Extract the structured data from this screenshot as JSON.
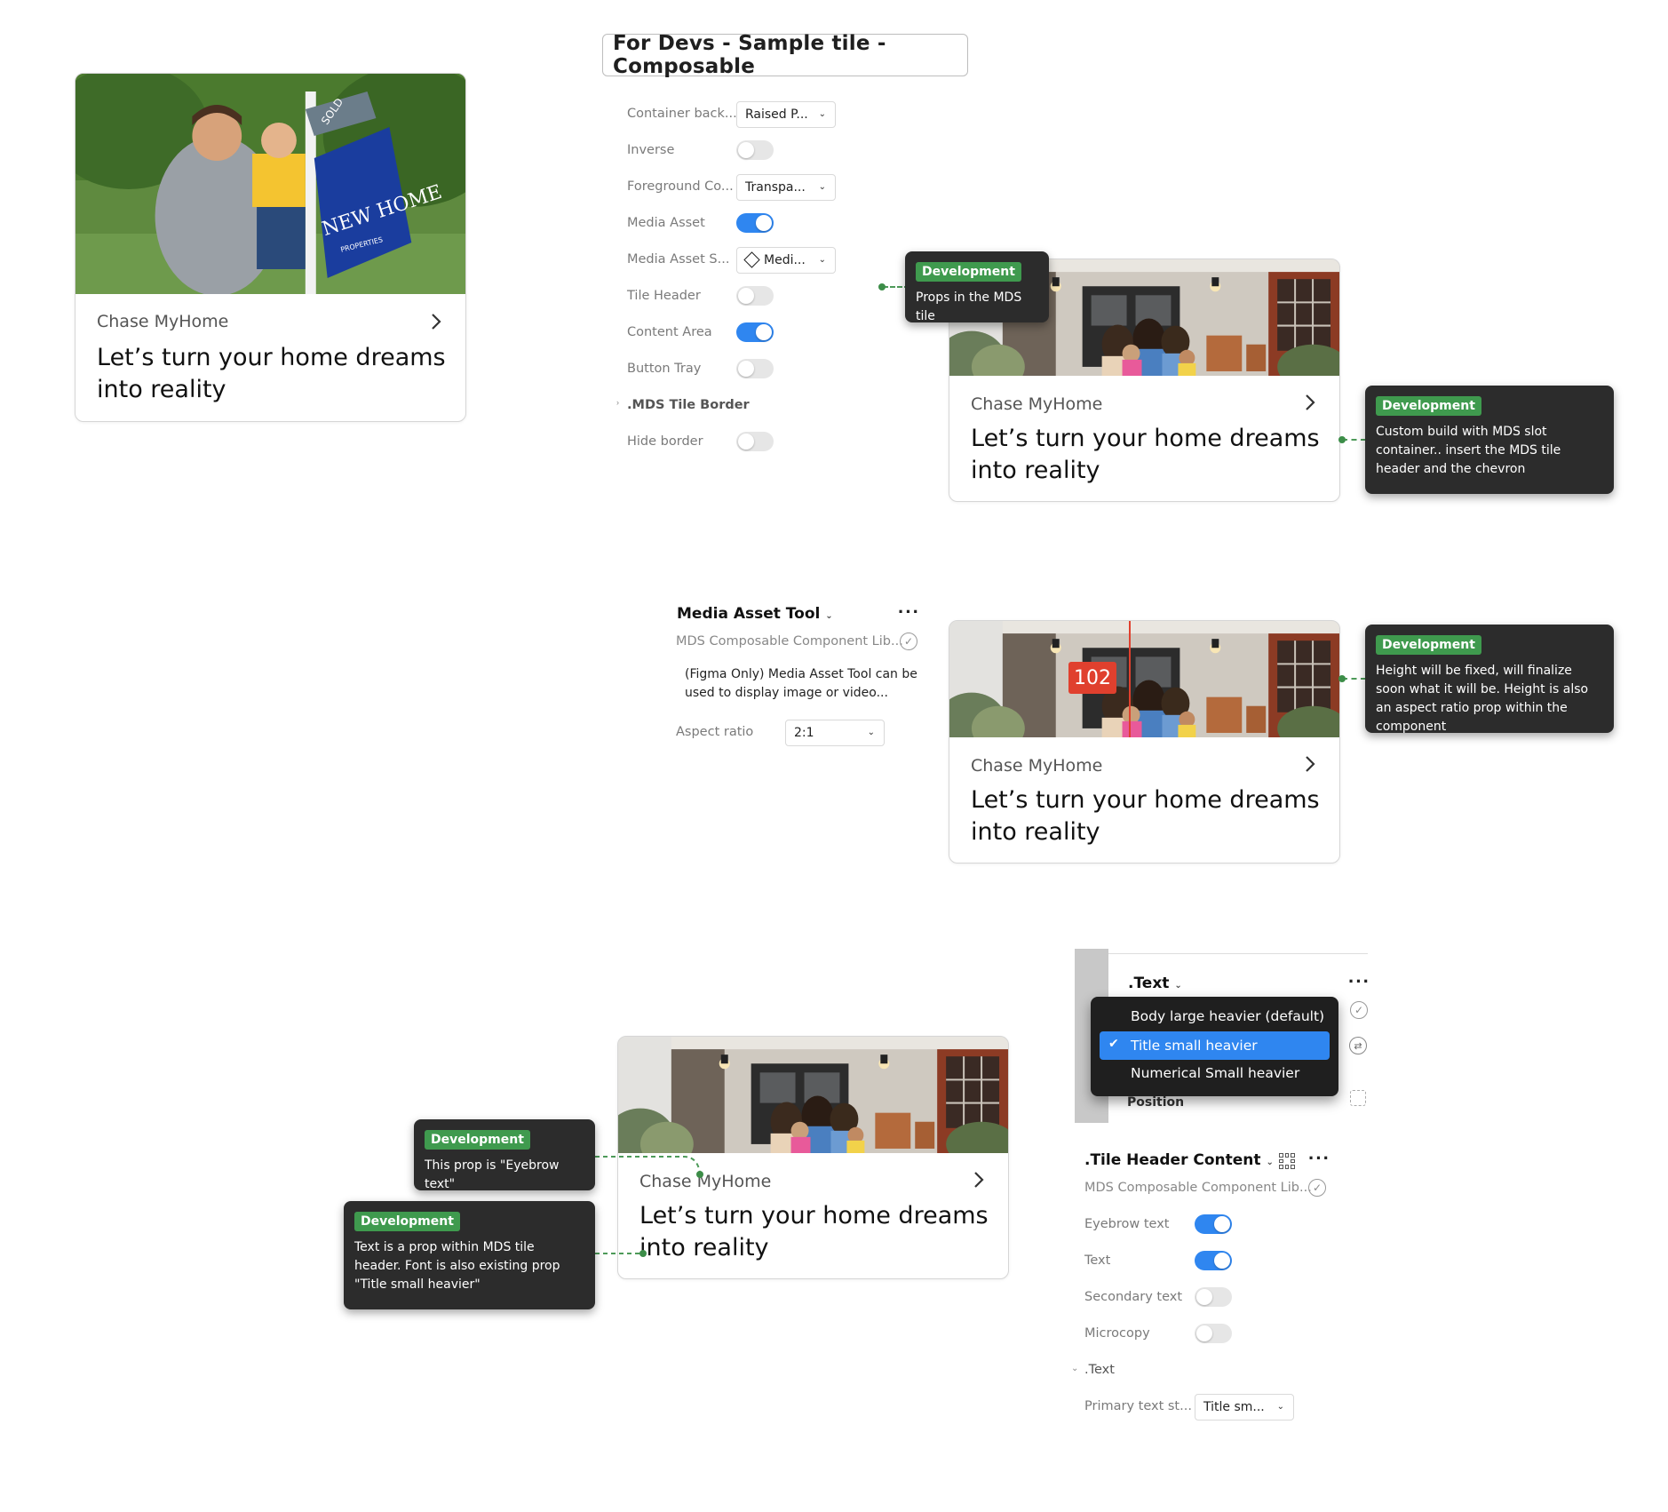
{
  "tile": {
    "eyebrow": "Chase MyHome",
    "title_line1": "Let’s turn your home dreams",
    "title_line2": "into reality",
    "sign_text1": "NEW HOME",
    "sign_text2": "PROPERTIES",
    "sign_text3": "SOLD"
  },
  "header_box": "For Devs - Sample tile - Composable",
  "props": [
    {
      "label": "Container back...",
      "type": "dropdown",
      "value": "Raised P..."
    },
    {
      "label": "Inverse",
      "type": "toggle",
      "on": false
    },
    {
      "label": "Foreground Co...",
      "type": "dropdown",
      "value": "Transpa..."
    },
    {
      "label": "Media Asset",
      "type": "toggle",
      "on": true
    },
    {
      "label": "Media Asset S...",
      "type": "dropdown",
      "value": "Medi...",
      "icon": "diamond-icon"
    },
    {
      "label": "Tile Header",
      "type": "toggle",
      "on": false
    },
    {
      "label": "Content Area",
      "type": "toggle",
      "on": true
    },
    {
      "label": "Button Tray",
      "type": "toggle",
      "on": false
    },
    {
      "label": ".MDS Tile Border",
      "type": "section"
    },
    {
      "label": "Hide border",
      "type": "toggle",
      "on": false
    }
  ],
  "tips": {
    "badge": "Development",
    "t1": "Props in the MDS tile",
    "t2": "Custom build with MDS slot container.. insert the MDS tile header and the chevron",
    "t3": "Height will be fixed, will finalize soon what it will be. Height is also an aspect ratio prop within the component",
    "t4": "This prop is \"Eyebrow text\"",
    "t5": "Text is a prop within MDS tile header. Font is also existing prop \"Title small heavier\""
  },
  "media_tool": {
    "title": "Media Asset Tool",
    "library": "MDS Composable Component Lib...",
    "desc_line1": "(Figma Only) Media Asset Tool can be",
    "desc_line2": "used to display image or video...",
    "aspect_label": "Aspect ratio",
    "aspect_value": "2:1",
    "measure": "102"
  },
  "text_panel": {
    "title": ".Text",
    "position_label": "Position",
    "menu": [
      {
        "label": "Body large heavier (default)",
        "selected": false
      },
      {
        "label": "Title small heavier",
        "selected": true
      },
      {
        "label": "Numerical Small heavier",
        "selected": false
      }
    ]
  },
  "header_content": {
    "title": ".Tile Header Content",
    "library": "MDS Composable Component Lib...",
    "props": [
      {
        "label": "Eyebrow text",
        "on": true
      },
      {
        "label": "Text",
        "on": true
      },
      {
        "label": "Secondary text",
        "on": false
      },
      {
        "label": "Microcopy",
        "on": false
      }
    ],
    "section": ".Text",
    "primary_label": "Primary text st...",
    "primary_value": "Title sm..."
  },
  "colors": {
    "accent": "#2f86f0",
    "dev_badge": "#3f9a4e",
    "tooltip_bg": "#2c2c2c",
    "measure_red": "#e0402e"
  }
}
